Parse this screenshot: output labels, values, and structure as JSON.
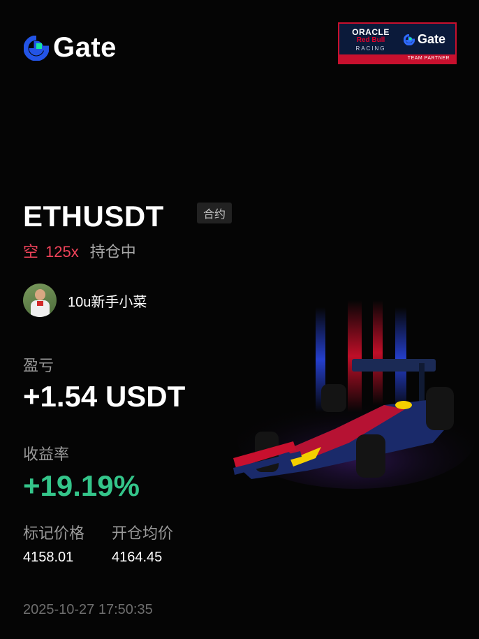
{
  "brand": {
    "name": "Gate",
    "logo_icon": "gate-logo-icon"
  },
  "partner_badge": {
    "line1": "ORACLE",
    "line2": "Red Bull",
    "line3": "RACING",
    "brand": "Gate",
    "strip": "TEAM PARTNER"
  },
  "position": {
    "pair": "ETHUSDT",
    "contract_tag": "合约",
    "direction": "空",
    "leverage": "125x",
    "status": "持仓中"
  },
  "user": {
    "name": "10u新手小菜",
    "avatar_icon": "user-avatar"
  },
  "stats": {
    "pnl_label": "盈亏",
    "pnl_value": "+1.54 USDT",
    "roi_label": "收益率",
    "roi_value": "+19.19%",
    "mark_price_label": "标记价格",
    "mark_price_value": "4158.01",
    "entry_price_label": "开仓均价",
    "entry_price_value": "4164.45"
  },
  "timestamp": "2025-10-27 17:50:35",
  "colors": {
    "background": "#050505",
    "short_red": "#f0435a",
    "profit_green": "#34c58a",
    "muted_text": "#9a9a9a",
    "brand_blue": "#2354e6",
    "brand_green": "#17e6a1"
  }
}
